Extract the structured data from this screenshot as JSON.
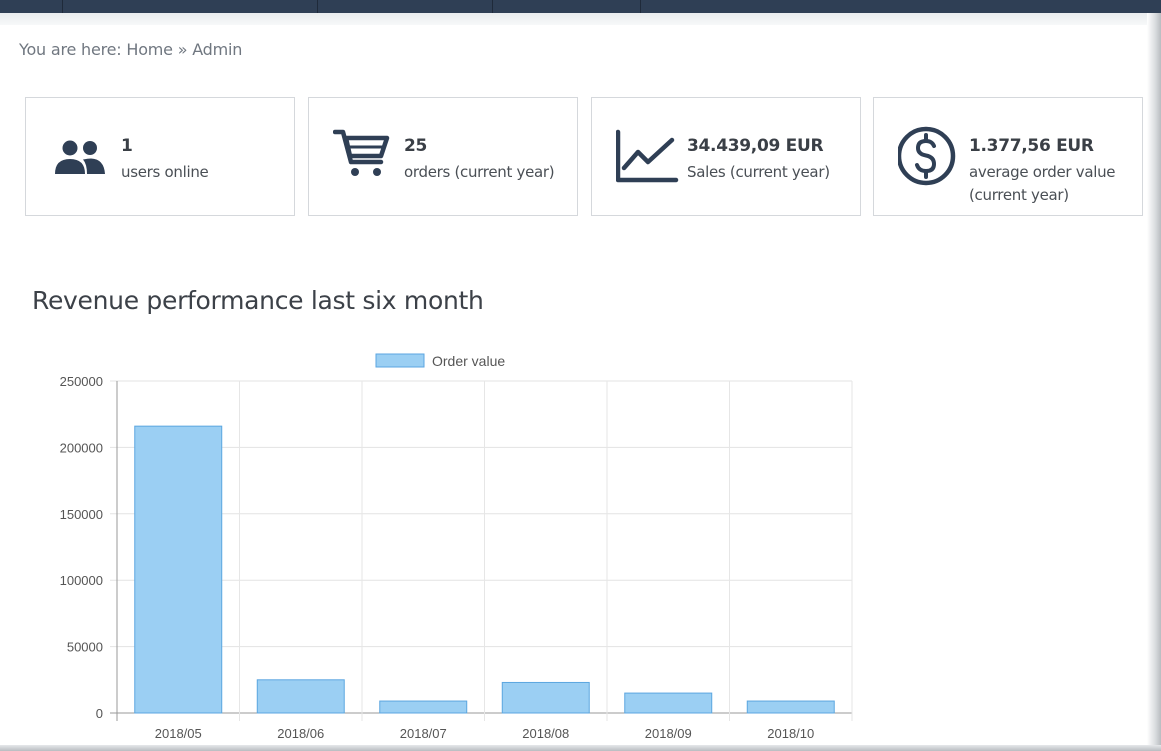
{
  "breadcrumb": {
    "prefix": "You are here:",
    "home": "Home",
    "separator": "»",
    "current": "Admin"
  },
  "stats": [
    {
      "icon": "users-icon",
      "value": "1",
      "label": "users online"
    },
    {
      "icon": "cart-icon",
      "value": "25",
      "label": "orders (current year)"
    },
    {
      "icon": "line-chart-icon",
      "value": "34.439,09 EUR",
      "label": "Sales (current year)"
    },
    {
      "icon": "dollar-circle-icon",
      "value": "1.377,56 EUR",
      "label": "average order value (current year)"
    }
  ],
  "section_title": "Revenue performance last six month",
  "colors": {
    "topbar": "#2f3f55",
    "icon": "#2f3f55",
    "bar_fill": "#9bcff3",
    "bar_stroke": "#5ba6e0"
  },
  "chart_data": {
    "type": "bar",
    "title": "",
    "categories": [
      "2018/05",
      "2018/06",
      "2018/07",
      "2018/08",
      "2018/09",
      "2018/10"
    ],
    "series": [
      {
        "name": "Order value",
        "values": [
          216000,
          25000,
          9000,
          23000,
          15000,
          9000
        ]
      }
    ],
    "ylim": [
      0,
      250000
    ],
    "yticks": [
      0,
      50000,
      100000,
      150000,
      200000,
      250000
    ],
    "grid": true,
    "legend": "top-center",
    "xlabel": "",
    "ylabel": ""
  }
}
